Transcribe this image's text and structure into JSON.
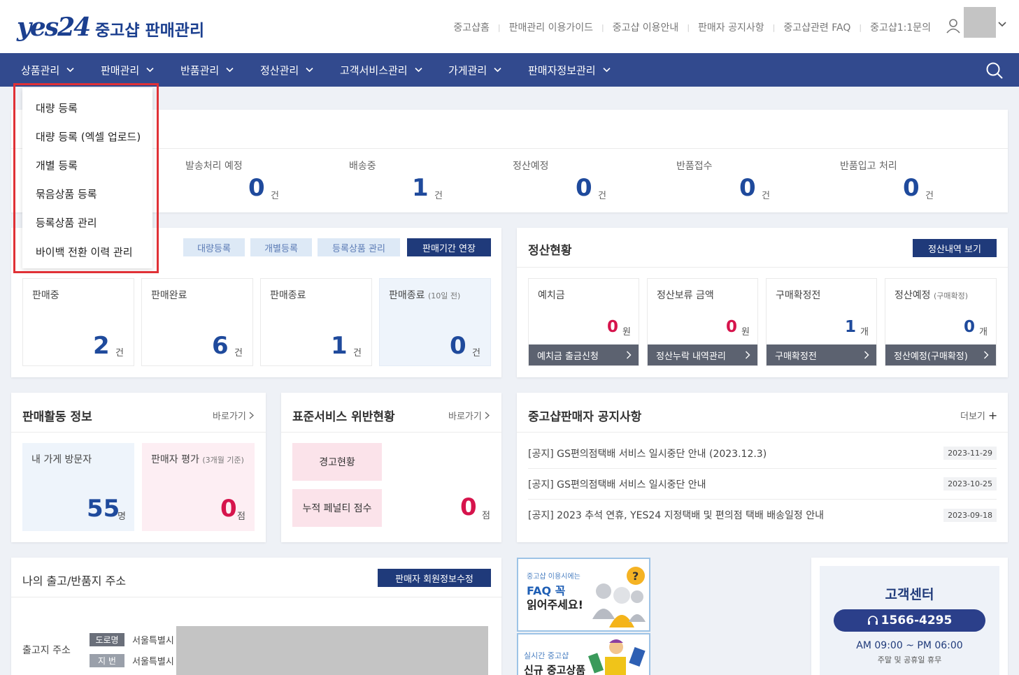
{
  "header": {
    "logo": "yes24",
    "title": "중고샵 판매관리",
    "links": [
      "중고샵홈",
      "판매관리 이용가이드",
      "중고샵 이용안내",
      "판매자 공지사항",
      "중고샵관련 FAQ",
      "중고샵1:1문의"
    ]
  },
  "nav": {
    "items": [
      "상품관리",
      "판매관리",
      "반품관리",
      "정산관리",
      "고객서비스관리",
      "가게관리",
      "판매자정보관리"
    ]
  },
  "dropdown": {
    "items": [
      "대량 등록",
      "대량 등록 (엑셀 업로드)",
      "개별 등록",
      "묶음상품 등록",
      "등록상품 관리",
      "바이백 전환 이력 관리"
    ]
  },
  "status": {
    "items": [
      {
        "label": "발송처리 예정",
        "value": "0",
        "unit": "건"
      },
      {
        "label": "배송중",
        "value": "1",
        "unit": "건"
      },
      {
        "label": "정산예정",
        "value": "0",
        "unit": "건"
      },
      {
        "label": "반품접수",
        "value": "0",
        "unit": "건"
      },
      {
        "label": "반품입고 처리",
        "value": "0",
        "unit": "건"
      }
    ]
  },
  "products": {
    "buttons": [
      "대량등록",
      "개별등록",
      "등록상품 관리"
    ],
    "extend_button": "판매기간 연장",
    "cards": [
      {
        "label": "판매중",
        "value": "2",
        "unit": "건"
      },
      {
        "label": "판매완료",
        "value": "6",
        "unit": "건"
      },
      {
        "label": "판매종료",
        "value": "1",
        "unit": "건"
      },
      {
        "label": "판매종료",
        "sub": "(10일 전)",
        "value": "0",
        "unit": "건"
      }
    ]
  },
  "settlement": {
    "title": "정산현황",
    "history_button": "정산내역 보기",
    "cards": [
      {
        "label": "예치금",
        "sub": "",
        "value": "0",
        "unit": "원",
        "action": "예치금 출금신청"
      },
      {
        "label": "정산보류 금액",
        "sub": "",
        "value": "0",
        "unit": "원",
        "action": "정산누락 내역관리"
      },
      {
        "label": "구매확정전",
        "sub": "",
        "value": "1",
        "unit": "개",
        "action": "구매확정전"
      },
      {
        "label": "정산예정",
        "sub": "(구매확정)",
        "value": "0",
        "unit": "개",
        "action": "정산예정(구매확정)"
      }
    ]
  },
  "activity": {
    "title": "판매활동 정보",
    "goto": "바로가기",
    "visitors_label": "내 가게 방문자",
    "visitors_value": "55",
    "visitors_unit": "명",
    "rating_label": "판매자 평가",
    "rating_sub": "(3개월 기준)",
    "rating_value": "0",
    "rating_unit": "점"
  },
  "violation": {
    "title": "표준서비스 위반현황",
    "goto": "바로가기",
    "warning": "경고현황",
    "penalty": "누적 페널티 점수",
    "penalty_value": "0",
    "penalty_unit": "점"
  },
  "notices": {
    "title": "중고샵판매자 공지사항",
    "more": "더보기",
    "items": [
      {
        "text": "[공지] GS편의점택배 서비스 일시중단 안내 (2023.12.3)",
        "date": "2023-11-29"
      },
      {
        "text": "[공지] GS편의점택배 서비스 일시중단 안내",
        "date": "2023-10-25"
      },
      {
        "text": "[공지] 2023 추석 연휴, YES24 지정택배 및 편의점 택배 배송일정 안내",
        "date": "2023-09-18"
      }
    ]
  },
  "address": {
    "title": "나의 출고/반품지 주소",
    "edit_button": "판매자 회원정보수정",
    "label": "출고지 주소",
    "road_tag": "도로명",
    "lot_tag": "지 번",
    "road_value": "서울특별시",
    "lot_value": "서울특별시"
  },
  "banners": {
    "faq_small": "중고샵 이용시에는",
    "faq_line1": "FAQ 꼭",
    "faq_line2": "읽어주세요!",
    "new_small": "실시간 중고샵",
    "new_line1": "신규 중고상품"
  },
  "support": {
    "title": "고객센터",
    "phone": "1566-4295",
    "hours": "AM 09:00 ~ PM 06:00",
    "note": "주말 및 공휴일 휴무"
  },
  "colors": {
    "nav": "#324a8e",
    "brand": "#1b3f8f",
    "number_blue": "#1f4a9c",
    "number_red": "#d6144c",
    "highlight": "#e03136"
  }
}
